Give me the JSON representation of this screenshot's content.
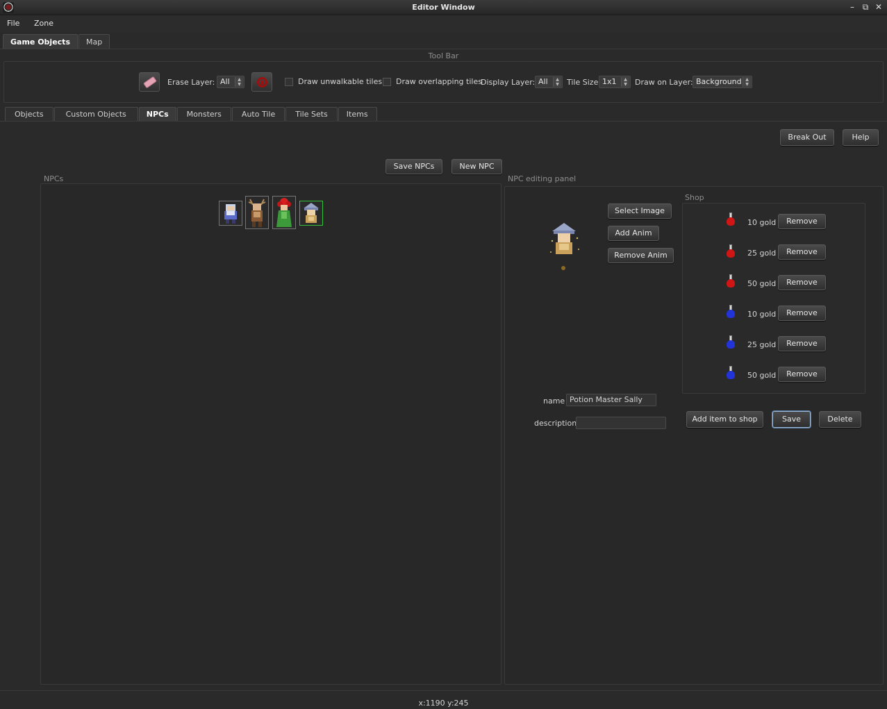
{
  "window": {
    "title": "Editor Window",
    "minimize": "–",
    "restore": "⧉",
    "close": "✕"
  },
  "menu": {
    "file": "File",
    "zone": "Zone"
  },
  "main_tabs": [
    {
      "label": "Game Objects",
      "active": true
    },
    {
      "label": "Map",
      "active": false
    }
  ],
  "toolbar": {
    "title": "Tool Bar",
    "erase_layer_label": "Erase Layer:",
    "erase_layer_value": "All",
    "draw_unwalkable_label": "Draw unwalkable tiles",
    "draw_overlapping_label": "Draw overlapping tiles",
    "display_layer_label": "Display Layer:",
    "display_layer_value": "All",
    "tile_size_label": "Tile Size",
    "tile_size_value": "1x1",
    "draw_on_layer_label": "Draw on Layer:",
    "draw_on_layer_value": "Background"
  },
  "sub_tabs": [
    {
      "label": "Objects"
    },
    {
      "label": "Custom Objects"
    },
    {
      "label": "NPCs"
    },
    {
      "label": "Monsters"
    },
    {
      "label": "Auto Tile"
    },
    {
      "label": "Tile Sets"
    },
    {
      "label": "Items"
    }
  ],
  "actions": {
    "break_out": "Break Out",
    "help": "Help",
    "save_npcs": "Save NPCs",
    "new_npc": "New NPC"
  },
  "npc_list": {
    "title": "NPCs"
  },
  "editor": {
    "title": "NPC editing panel",
    "select_image": "Select Image",
    "add_anim": "Add Anim",
    "remove_anim": "Remove Anim",
    "name_label": "name",
    "name_value": "Potion Master Sally",
    "description_label": "description",
    "description_value": "",
    "add_item": "Add item to shop",
    "save": "Save",
    "delete": "Delete"
  },
  "shop": {
    "title": "Shop",
    "items": [
      {
        "price": "10 gold",
        "remove": "Remove",
        "color": "#d01515"
      },
      {
        "price": "25 gold",
        "remove": "Remove",
        "color": "#d01515"
      },
      {
        "price": "50 gold",
        "remove": "Remove",
        "color": "#d01515"
      },
      {
        "price": "10 gold",
        "remove": "Remove",
        "color": "#2233d8"
      },
      {
        "price": "25 gold",
        "remove": "Remove",
        "color": "#2233d8"
      },
      {
        "price": "50 gold",
        "remove": "Remove",
        "color": "#2233d8"
      }
    ]
  },
  "status": {
    "coords": "x:1190 y:245"
  }
}
